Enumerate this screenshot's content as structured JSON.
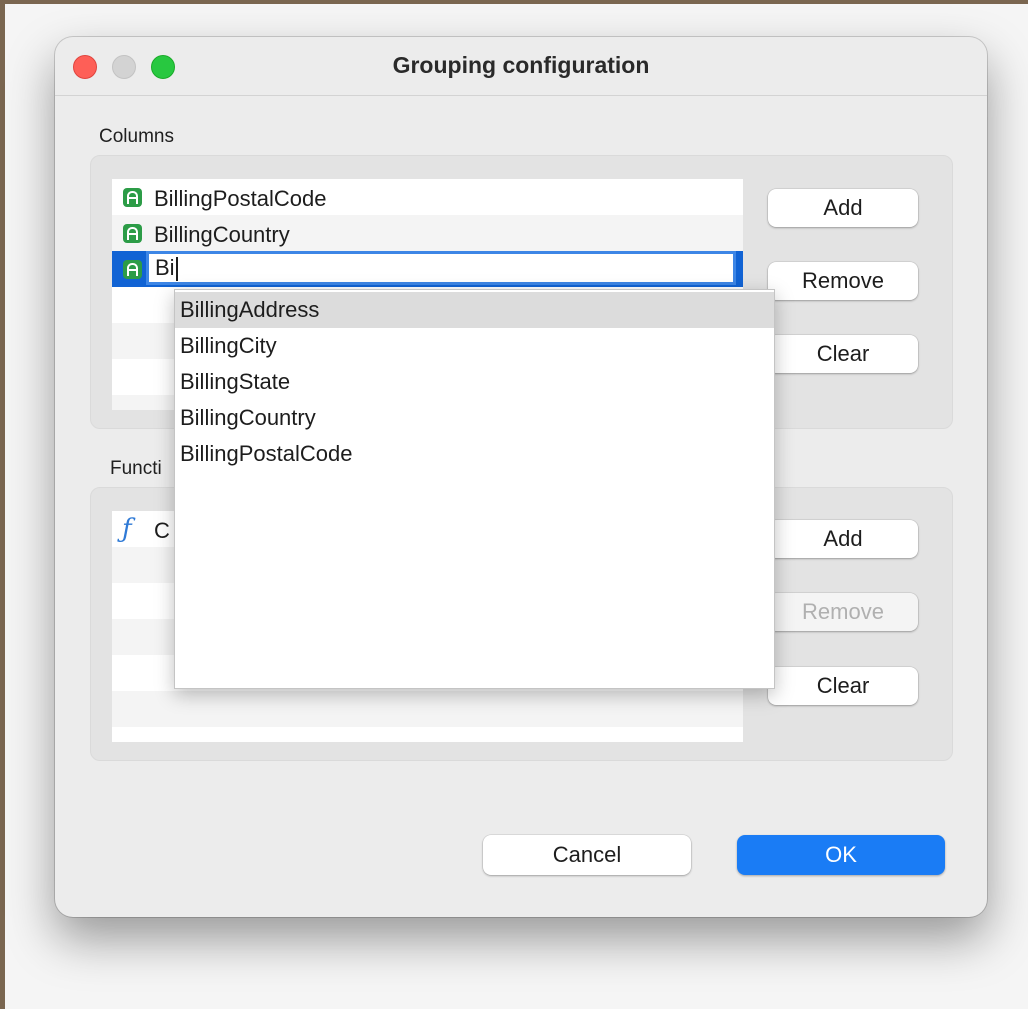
{
  "window": {
    "title": "Grouping configuration"
  },
  "columns": {
    "label": "Columns",
    "items": [
      {
        "label": "BillingPostalCode"
      },
      {
        "label": "BillingCountry"
      }
    ],
    "editing_value": "Bi",
    "buttons": {
      "add": "Add",
      "remove": "Remove",
      "clear": "Clear"
    }
  },
  "functions": {
    "label": "Functi",
    "items": [
      {
        "label": "C"
      }
    ],
    "buttons": {
      "add": "Add",
      "remove": "Remove",
      "clear": "Clear",
      "remove_disabled": true
    }
  },
  "autocomplete": {
    "items": [
      "BillingAddress",
      "BillingCity",
      "BillingState",
      "BillingCountry",
      "BillingPostalCode"
    ],
    "highlighted": "BillingAddress"
  },
  "footer": {
    "cancel": "Cancel",
    "ok": "OK"
  },
  "colors": {
    "accent": "#1a7cf5",
    "selection": "#1163d4",
    "column_icon": "#2c9c47",
    "function_icon": "#2f7ad6"
  },
  "icons": {
    "column": "column-type-icon",
    "function": "function-icon"
  }
}
